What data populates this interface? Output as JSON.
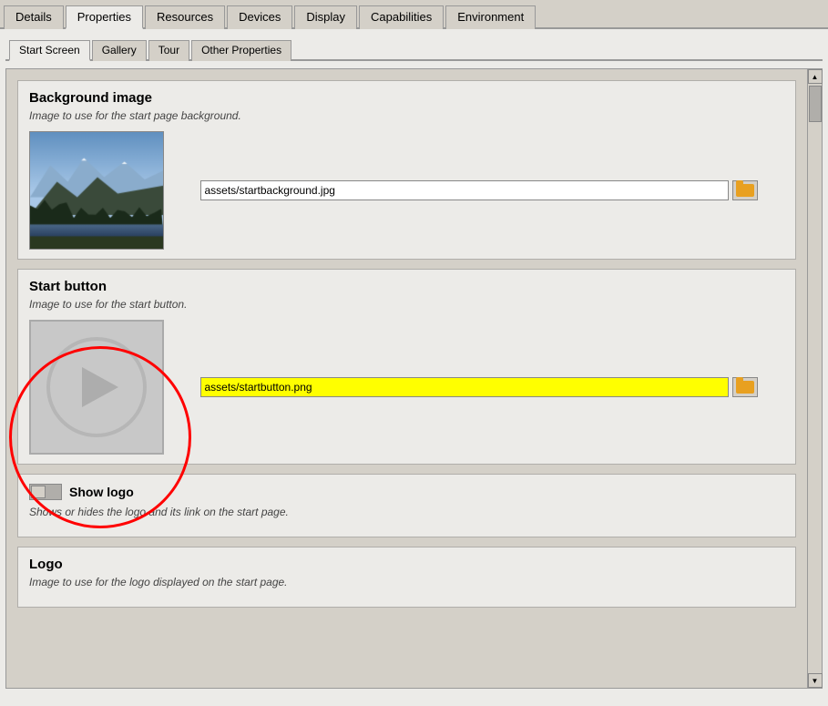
{
  "topTabs": {
    "tabs": [
      {
        "label": "Details",
        "active": false
      },
      {
        "label": "Properties",
        "active": true
      },
      {
        "label": "Resources",
        "active": false
      },
      {
        "label": "Devices",
        "active": false
      },
      {
        "label": "Display",
        "active": false
      },
      {
        "label": "Capabilities",
        "active": false
      },
      {
        "label": "Environment",
        "active": false
      }
    ]
  },
  "subTabs": {
    "tabs": [
      {
        "label": "Start Screen",
        "active": true
      },
      {
        "label": "Gallery",
        "active": false
      },
      {
        "label": "Tour",
        "active": false
      },
      {
        "label": "Other Properties",
        "active": false
      }
    ]
  },
  "sections": {
    "backgroundImage": {
      "title": "Background image",
      "description": "Image to use for the start page background.",
      "filePath": "assets/startbackground.jpg",
      "folderBtnLabel": "📁"
    },
    "startButton": {
      "title": "Start button",
      "description": "Image to use for the start button.",
      "filePath": "assets/startbutton.png",
      "folderBtnLabel": "📁",
      "highlighted": true
    },
    "showLogo": {
      "title": "Show logo",
      "description": "Shows or hides the logo and its link on the start page.",
      "toggleValue": false
    },
    "logo": {
      "title": "Logo",
      "description": "Image to use for the logo displayed on the start page."
    }
  },
  "colors": {
    "highlight": "#ffff00",
    "redCircle": "red",
    "folderColor": "#e8a020"
  }
}
